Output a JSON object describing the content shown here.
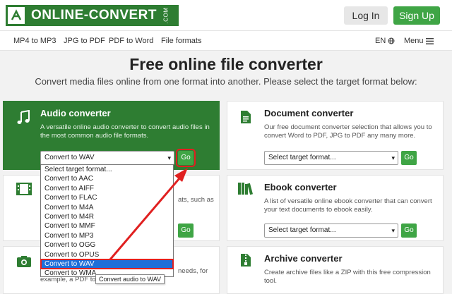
{
  "header": {
    "logo_text": "ONLINE-CONVERT",
    "logo_com": ".COM",
    "login_label": "Log In",
    "signup_label": "Sign Up"
  },
  "nav": {
    "items": [
      "MP4 to MP3",
      "JPG to PDF",
      "PDF to Word",
      "File formats"
    ],
    "language": "EN",
    "menu_label": "Menu"
  },
  "hero": {
    "title": "Free online file converter",
    "subtitle": "Convert media files online from one format into another. Please select the target format below:"
  },
  "cards": {
    "audio": {
      "title": "Audio converter",
      "desc": "A versatile online audio converter to convert audio files in the most common audio file formats.",
      "selected": "Convert to WAV",
      "go": "Go"
    },
    "document": {
      "title": "Document converter",
      "desc": "Our free document converter selection that allows you to convert Word to PDF, JPG to PDF any many more.",
      "placeholder": "Select target format...",
      "go": "Go"
    },
    "video": {
      "desc_fragment": "ats, such as",
      "go": "Go"
    },
    "ebook": {
      "title": "Ebook converter",
      "desc": "A list of versatile online ebook converter that can convert your text documents to ebook easily.",
      "placeholder": "Select target format...",
      "go": "Go"
    },
    "image": {
      "desc_fragment_1": "needs, for",
      "desc_fragment_2": "example, a PDF to"
    },
    "archive": {
      "title": "Archive converter",
      "desc": "Create archive files like a ZIP with this free compression tool."
    }
  },
  "dropdown": {
    "options": [
      "Select target format...",
      "Convert to AAC",
      "Convert to AIFF",
      "Convert to FLAC",
      "Convert to M4A",
      "Convert to M4R",
      "Convert to MMF",
      "Convert to MP3",
      "Convert to OGG",
      "Convert to OPUS",
      "Convert to WAV",
      "Convert to WMA"
    ],
    "selected_index": 10
  },
  "tooltip": "Convert audio to WAV",
  "colors": {
    "brand_green": "#2e7d32",
    "button_green": "#3fa545",
    "highlight_red": "#e02020",
    "selection_blue": "#1e6fd9"
  }
}
